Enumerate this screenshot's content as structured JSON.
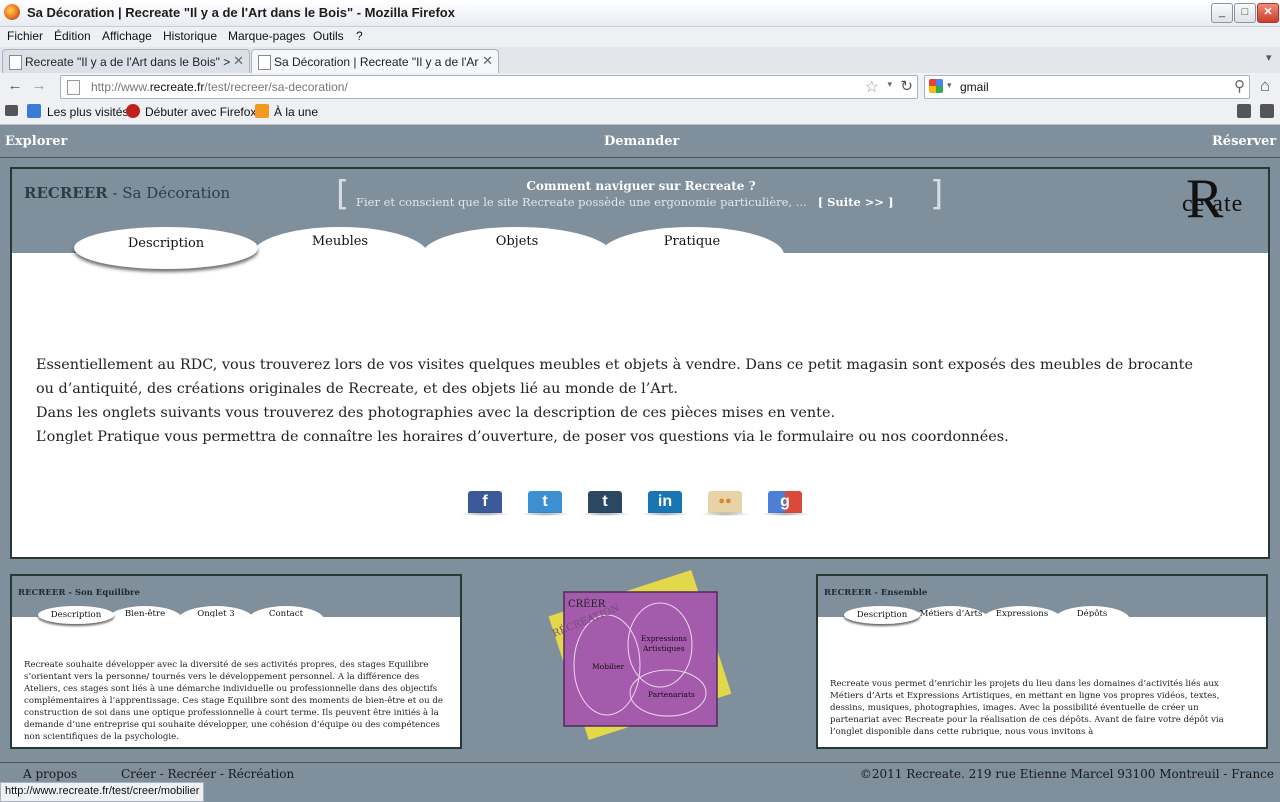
{
  "window": {
    "title": "Sa Décoration | Recreate \"Il y a de l'Art dans le Bois\" - Mozilla Firefox",
    "controls": {
      "minimize": "_",
      "maximize": "□",
      "close": "✕"
    }
  },
  "menu": [
    "Fichier",
    "Édition",
    "Affichage",
    "Historique",
    "Marque-pages",
    "Outils",
    "?"
  ],
  "tabs": [
    {
      "label": "Recreate \"Il y a de l'Art dans le Bois\" > Se...",
      "close": "✕"
    },
    {
      "label": "Sa Décoration | Recreate \"Il y a de l'Art d...",
      "close": "✕"
    }
  ],
  "tab_overflow": "▾",
  "nav": {
    "back": "←",
    "forward": "→",
    "url_prefix": "http://www.",
    "url_domain": "recreate.fr",
    "url_path": "/test/recreer/sa-decoration/",
    "star": "☆",
    "dropdown": "▾",
    "reload": "↻",
    "search_query": "gmail",
    "search_icon": "⚲",
    "home": "⌂"
  },
  "bookmarks": [
    "Les plus visités",
    "Débuter avec Firefox",
    "À la une"
  ],
  "site": {
    "topnav": {
      "left": "Explorer",
      "center": "Demander",
      "right": "Réserver"
    },
    "heading_strong": "RECREER",
    "heading_rest": " - Sa Décoration",
    "howto": {
      "title": "Comment naviguer sur Recreate ?",
      "text": "Fier et conscient que le site Recreate possède une ergonomie particulière, ...",
      "more": "[ Suite >> ]",
      "open_bracket": "[",
      "close_bracket": "]"
    },
    "logo": {
      "r": "R",
      "text": "ce ate"
    },
    "page_tabs": [
      "Description",
      "Meubles",
      "Objets",
      "Pratique"
    ],
    "body": [
      "Essentiellement au RDC, vous trouverez lors de vos visites quelques meubles et objets à vendre. Dans ce petit magasin sont exposés des meubles de brocante ou d’antiquité, des créations originales de Recreate, et des objets lié au monde de l’Art.",
      "Dans les onglets suivants vous trouverez des photographies avec la description de ces pièces mises en vente.",
      "L’onglet Pratique vous permettra de connaître les horaires d’ouverture, de poser vos questions via le formulaire ou nos coordonnées."
    ],
    "social": [
      {
        "name": "facebook",
        "glyph": "f",
        "color": "#3b5998"
      },
      {
        "name": "twitter",
        "glyph": "t",
        "color": "#3c8fd0"
      },
      {
        "name": "tumblr",
        "glyph": "t",
        "color": "#2c4762"
      },
      {
        "name": "linkedin",
        "glyph": "in",
        "color": "#1a75b5"
      },
      {
        "name": "flickr",
        "glyph": "●●",
        "color": "#e8d3a8"
      },
      {
        "name": "google",
        "glyph": "g",
        "color": "#4d7fd6"
      }
    ],
    "left_panel": {
      "title": "RECREER - Son Equilibre",
      "tabs": [
        "Description",
        "Bien-être",
        "Onglet 3",
        "Contact"
      ],
      "text": "Recreate souhaite développer avec la diversité de ses activités propres, des stages Equilibre s’orientant vers la personne/ tournés vers le développement personnel. A la différence des Ateliers, ces stages sont liés à une démarche individuelle ou professionnelle dans des objectifs complémentaires à l’apprentissage. Ces stage Equilibre sont des moments de bien-être et ou de construction de soi dans une optique professionnelle à court terme. Ils peuvent être initiés à la demande d’une entreprise qui souhaite développer, une cohésion d’équipe ou des compétences non scientifiques de la psychologie."
    },
    "diagram": {
      "creer": "CRÉER",
      "recreation": "RÉCRÉATION",
      "mobilier": "Mobilier",
      "expressions": "Expressions",
      "artistiques": "Artistiques",
      "partenariats": "Partenariats"
    },
    "right_panel": {
      "title": "RECREER - Ensemble",
      "tabs": [
        "Description",
        "Métiers d’Arts",
        "Expressions",
        "Dépôts"
      ],
      "text": "Recreate vous permet d’enrichir les projets du lieu dans les domaines d’activités liés aux Métiers d’Arts et Expressions Artistiques, en mettant en ligne vos propres vidéos, textes, dessins, musiques, photographies, images. Avec la possibilité éventuelle de créer un partenariat avec Recreate pour la réalisation de ces dépôts. Avant de faire votre dépôt via l’onglet disponible dans cette rubrique, nous vous invitons à"
    },
    "footer": {
      "apropos": "A propos",
      "links": "Créer - Recréer - Récréation",
      "copyright": "©2011 Recreate. 219 rue Etienne Marcel 93100 Montreuil - France"
    }
  },
  "status": "http://www.recreate.fr/test/creer/mobilier"
}
